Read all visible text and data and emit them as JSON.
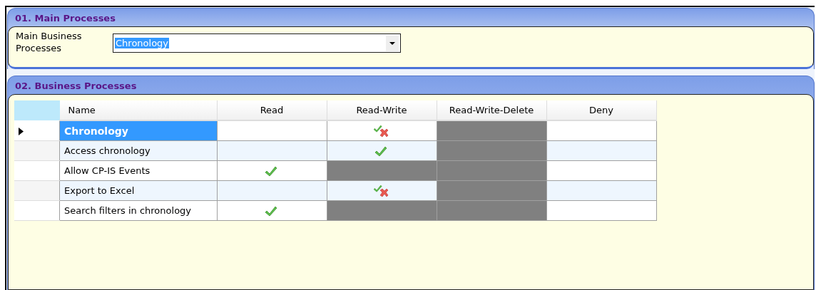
{
  "main_panel": {
    "title": "01. Main Processes",
    "field_label": "Main Business Processes",
    "dropdown_value": "Chronology"
  },
  "business_panel": {
    "title": "02. Business Processes",
    "table": {
      "columns": [
        "Name",
        "Read",
        "Read-Write",
        "Read-Write-Delete",
        "Deny"
      ],
      "rows": [
        {
          "name": "Chronology",
          "selected": true,
          "cells": [
            {
              "kind": "empty"
            },
            {
              "kind": "partial"
            },
            {
              "kind": "disabled"
            },
            {
              "kind": "empty"
            }
          ]
        },
        {
          "name": "Access chronology",
          "selected": false,
          "cells": [
            {
              "kind": "empty"
            },
            {
              "kind": "check"
            },
            {
              "kind": "disabled"
            },
            {
              "kind": "empty"
            }
          ]
        },
        {
          "name": "Allow CP-IS Events",
          "selected": false,
          "cells": [
            {
              "kind": "check"
            },
            {
              "kind": "disabled"
            },
            {
              "kind": "disabled"
            },
            {
              "kind": "empty"
            }
          ]
        },
        {
          "name": "Export to Excel",
          "selected": false,
          "cells": [
            {
              "kind": "empty"
            },
            {
              "kind": "partial"
            },
            {
              "kind": "disabled"
            },
            {
              "kind": "empty"
            }
          ]
        },
        {
          "name": "Search filters in chronology",
          "selected": false,
          "cells": [
            {
              "kind": "check"
            },
            {
              "kind": "disabled"
            },
            {
              "kind": "disabled"
            },
            {
              "kind": "empty"
            }
          ]
        }
      ]
    }
  }
}
